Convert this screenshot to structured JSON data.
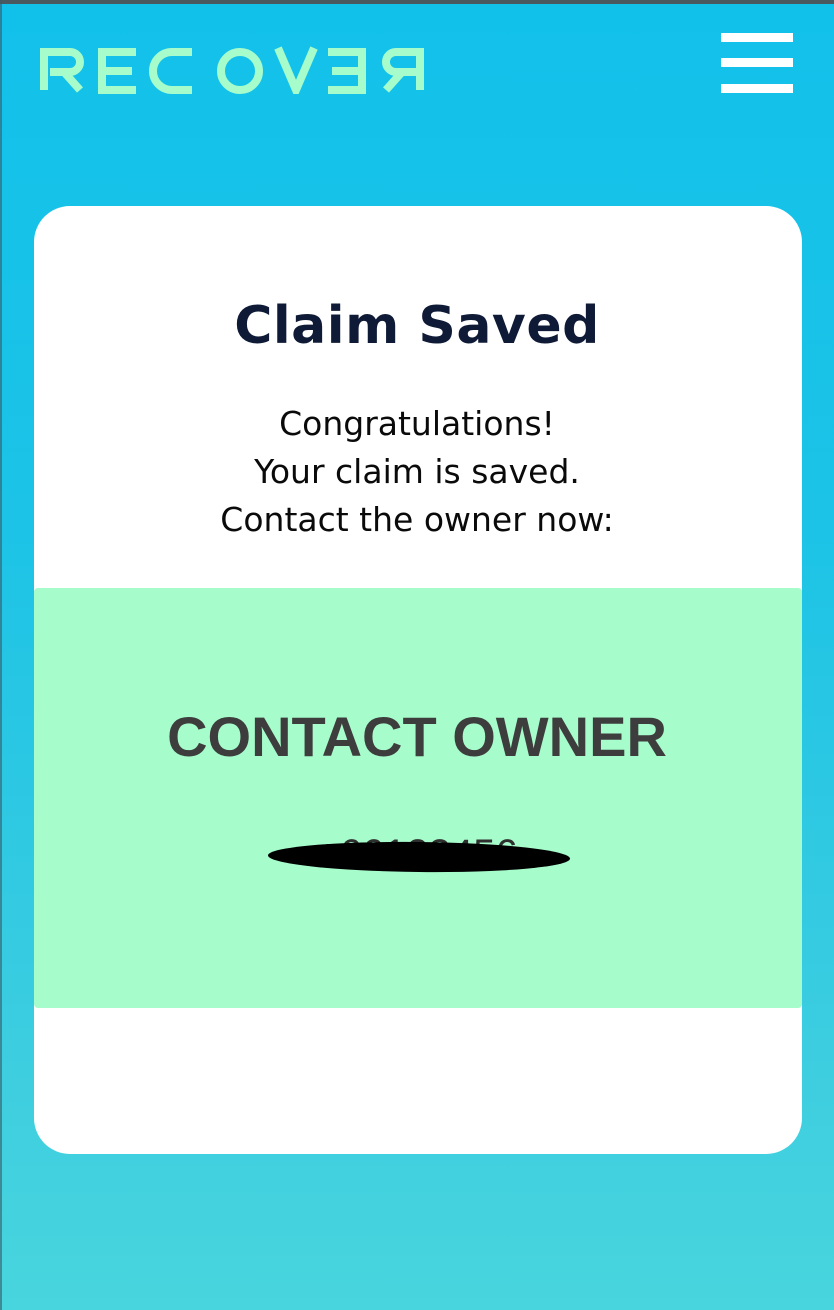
{
  "header": {
    "logo_text": "RECOVƎR",
    "menu_icon": "hamburger-menu-icon"
  },
  "card": {
    "title": "Claim Saved",
    "message_lines": [
      "Congratulations!",
      "Your claim is saved.",
      "Contact the owner now:"
    ]
  },
  "contact": {
    "label": "CONTACT OWNER",
    "phone": "+66123456"
  },
  "colors": {
    "background": "#12c1ea",
    "logo": "#a7fccb",
    "card": "#ffffff",
    "panel": "#a7fccb",
    "title": "#0e1a36",
    "label": "#3d3d3d"
  }
}
